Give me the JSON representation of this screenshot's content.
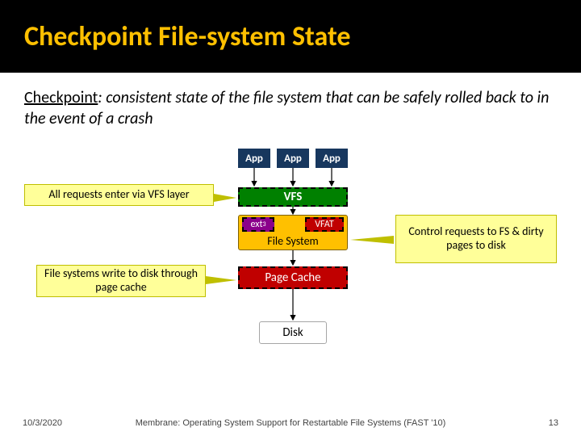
{
  "title": "Checkpoint File-system State",
  "definition": {
    "term": "Checkpoint",
    "rest": ": consistent state of the file system that can be safely rolled back to in the event of a crash"
  },
  "apps": [
    "App",
    "App",
    "App"
  ],
  "vfs": "VFS",
  "fs": {
    "ext3": "ext",
    "ext3_sub": "3",
    "vfat": "VFAT",
    "label": "File System"
  },
  "pagecache": "Page Cache",
  "disk": "Disk",
  "callouts": {
    "left1": "All requests enter via VFS layer",
    "left2": "File systems write to disk through page cache",
    "right": "Control requests to FS & dirty pages to disk"
  },
  "footer": {
    "date": "10/3/2020",
    "center": "Membrane: Operating System Support for Restartable File Systems (FAST '10)",
    "page": "13"
  }
}
